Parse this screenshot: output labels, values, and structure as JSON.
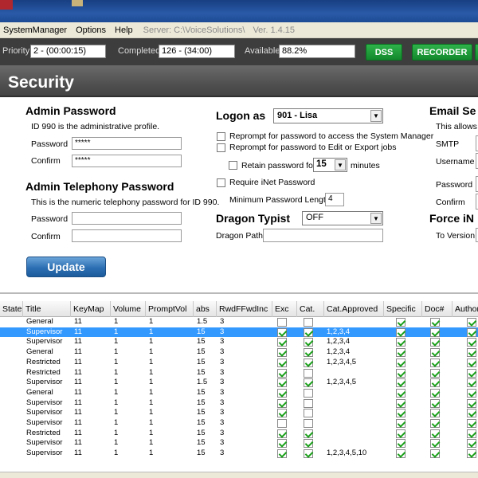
{
  "menubar": {
    "items": [
      "SystemManager",
      "Options",
      "Help"
    ],
    "server_label": "Server: C:\\VoiceSolutions\\",
    "version": "Ver. 1.4.15"
  },
  "toolbar": {
    "priority_label": "Priority",
    "priority_value": "2 - (00:00:15)",
    "completed_label": "Completed",
    "completed_value": "126 - (34:00)",
    "available_label": "Available",
    "available_value": "88.2%",
    "dss_label": "DSS",
    "recorder_label": "RECORDER"
  },
  "banner": {
    "title": "Security"
  },
  "admin_password": {
    "heading": "Admin Password",
    "desc": "ID 990 is the administrative profile.",
    "password_label": "Password",
    "password_value": "*****",
    "confirm_label": "Confirm",
    "confirm_value": "*****"
  },
  "admin_telephony": {
    "heading": "Admin Telephony Password",
    "desc": "This is the numeric telephony password for ID 990.",
    "password_label": "Password",
    "confirm_label": "Confirm"
  },
  "update_label": "Update",
  "logon": {
    "heading": "Logon as",
    "selected": "901 - Lisa",
    "reprompt_access": "Reprompt for password to access the System Manager",
    "reprompt_edit": "Reprompt for password to Edit or Export jobs",
    "retain_label": "Retain password for",
    "retain_value": "15",
    "minutes_label": "minutes",
    "require_inet": "Require iNet Password",
    "min_length_label": "Minimum Password Length",
    "min_length_value": "4"
  },
  "dragon": {
    "heading": "Dragon Typist",
    "selected": "OFF",
    "path_label": "Dragon Path"
  },
  "email": {
    "heading": "Email Se",
    "desc": "This allows f",
    "smtp_label": "SMTP",
    "username_label": "Username",
    "password_label": "Password",
    "confirm_label": "Confirm"
  },
  "force": {
    "heading": "Force iN",
    "to_version_label": "To Version"
  },
  "table": {
    "columns": [
      "State",
      "Title",
      "KeyMap",
      "Volume",
      "PromptVol",
      "abs",
      "RwdFFwdInc",
      "Exc",
      "Cat.",
      "Cat.Approved",
      "Specific",
      "Doc#",
      "Author"
    ],
    "rows": [
      {
        "title": "General",
        "keymap": "11",
        "volume": "1",
        "promptvol": "1",
        "abs": "1.5",
        "rwd": "3",
        "exc": false,
        "cat": false,
        "approved": "",
        "specific": true,
        "doc": true,
        "author": true
      },
      {
        "title": "Supervisor",
        "keymap": "11",
        "volume": "1",
        "promptvol": "1",
        "abs": "15",
        "rwd": "3",
        "exc": true,
        "cat": true,
        "approved": "1,2,3,4",
        "specific": true,
        "doc": true,
        "author": true
      },
      {
        "title": "Supervisor",
        "keymap": "11",
        "volume": "1",
        "promptvol": "1",
        "abs": "15",
        "rwd": "3",
        "exc": true,
        "cat": true,
        "approved": "1,2,3,4",
        "specific": true,
        "doc": true,
        "author": true
      },
      {
        "title": "General",
        "keymap": "11",
        "volume": "1",
        "promptvol": "1",
        "abs": "15",
        "rwd": "3",
        "exc": true,
        "cat": true,
        "approved": "1,2,3,4",
        "specific": true,
        "doc": true,
        "author": true
      },
      {
        "title": "Restricted",
        "keymap": "11",
        "volume": "1",
        "promptvol": "1",
        "abs": "15",
        "rwd": "3",
        "exc": true,
        "cat": true,
        "approved": "1,2,3,4,5",
        "specific": true,
        "doc": true,
        "author": true
      },
      {
        "title": "Restricted",
        "keymap": "11",
        "volume": "1",
        "promptvol": "1",
        "abs": "15",
        "rwd": "3",
        "exc": true,
        "cat": false,
        "approved": "",
        "specific": true,
        "doc": true,
        "author": true
      },
      {
        "title": "Supervisor",
        "keymap": "11",
        "volume": "1",
        "promptvol": "1",
        "abs": "1.5",
        "rwd": "3",
        "exc": true,
        "cat": true,
        "approved": "1,2,3,4,5",
        "specific": true,
        "doc": true,
        "author": true
      },
      {
        "title": "General",
        "keymap": "11",
        "volume": "1",
        "promptvol": "1",
        "abs": "15",
        "rwd": "3",
        "exc": true,
        "cat": false,
        "approved": "",
        "specific": true,
        "doc": true,
        "author": true
      },
      {
        "title": "Supervisor",
        "keymap": "11",
        "volume": "1",
        "promptvol": "1",
        "abs": "15",
        "rwd": "3",
        "exc": true,
        "cat": false,
        "approved": "",
        "specific": true,
        "doc": true,
        "author": true
      },
      {
        "title": "Supervisor",
        "keymap": "11",
        "volume": "1",
        "promptvol": "1",
        "abs": "15",
        "rwd": "3",
        "exc": true,
        "cat": false,
        "approved": "",
        "specific": true,
        "doc": true,
        "author": true
      },
      {
        "title": "Supervisor",
        "keymap": "11",
        "volume": "1",
        "promptvol": "1",
        "abs": "15",
        "rwd": "3",
        "exc": false,
        "cat": false,
        "approved": "",
        "specific": true,
        "doc": true,
        "author": true
      },
      {
        "title": "Restricted",
        "keymap": "11",
        "volume": "1",
        "promptvol": "1",
        "abs": "15",
        "rwd": "3",
        "exc": true,
        "cat": true,
        "approved": "",
        "specific": true,
        "doc": true,
        "author": true
      },
      {
        "title": "Supervisor",
        "keymap": "11",
        "volume": "1",
        "promptvol": "1",
        "abs": "15",
        "rwd": "3",
        "exc": true,
        "cat": true,
        "approved": "",
        "specific": true,
        "doc": true,
        "author": true
      },
      {
        "title": "Supervisor",
        "keymap": "11",
        "volume": "1",
        "promptvol": "1",
        "abs": "15",
        "rwd": "3",
        "exc": true,
        "cat": true,
        "approved": "1,2,3,4,5,10",
        "specific": true,
        "doc": true,
        "author": true
      }
    ]
  }
}
